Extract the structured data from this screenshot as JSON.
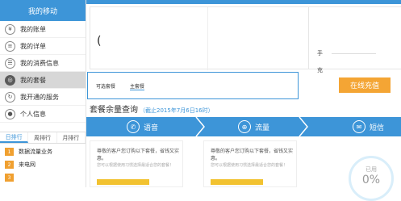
{
  "sidebar": {
    "title": "我的移动",
    "items": [
      {
        "label": "我的账单",
        "icon": "bill-icon",
        "glyph": "¥"
      },
      {
        "label": "我的详单",
        "icon": "detail-icon",
        "glyph": "≡"
      },
      {
        "label": "我的消费信息",
        "icon": "consumption-icon",
        "glyph": "☰"
      },
      {
        "label": "我的套餐",
        "icon": "package-icon",
        "glyph": "◎",
        "active": true
      },
      {
        "label": "我开通的服务",
        "icon": "service-icon",
        "glyph": "↻"
      },
      {
        "label": "个人信息",
        "icon": "user-icon",
        "glyph": "●"
      }
    ],
    "rank_tabs": [
      "日排行",
      "周排行",
      "月排行"
    ],
    "rank_items": [
      {
        "num": "1",
        "label": "数据流量业务"
      },
      {
        "num": "2",
        "label": "来电网"
      },
      {
        "num": "3",
        "label": ""
      }
    ]
  },
  "info": {
    "bracket": "(",
    "right_label_1": "手",
    "right_label_2": "充"
  },
  "packages": {
    "tab_optional": "可选套餐",
    "tab_main": "主套餐"
  },
  "recharge_label": "在线充值",
  "query": {
    "title": "套餐余量查询",
    "subtitle": "（截止2015年7月6日16时）"
  },
  "categories": [
    {
      "label": "语音",
      "icon": "phone-icon",
      "glyph": "✆"
    },
    {
      "label": "流量",
      "icon": "globe-icon",
      "glyph": "⊕"
    },
    {
      "label": "短信",
      "icon": "mail-icon",
      "glyph": "✉"
    }
  ],
  "cards": [
    {
      "text": "尊敬的客户您订购以下套餐，省钱又实惠。",
      "hint": "您可以根据使用习惯选择最适合您的套餐！"
    },
    {
      "text": "尊敬的客户您订购以下套餐，省钱又实惠。",
      "hint": "您可以根据使用习惯选择最适合您的套餐！"
    }
  ],
  "usage": {
    "label": "已用",
    "percent": "0%"
  },
  "colors": {
    "primary": "#3d95d8",
    "accent": "#f4a534",
    "progress": "#f2c230"
  }
}
